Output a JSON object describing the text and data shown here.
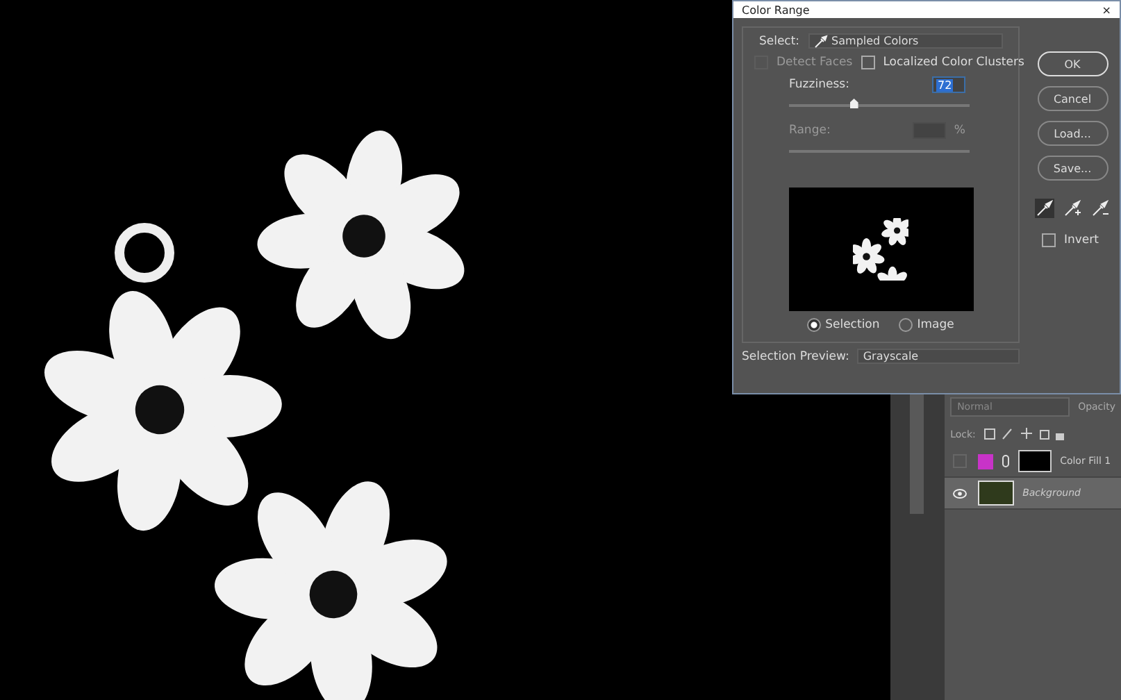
{
  "dialog": {
    "title": "Color Range",
    "close": "×",
    "select": {
      "label": "Select:",
      "value": "Sampled Colors"
    },
    "options": [
      {
        "label": "Detect Faces",
        "checked": false,
        "disabled": true
      },
      {
        "label": "Localized Color Clusters",
        "checked": false,
        "disabled": false
      }
    ],
    "fuzziness": {
      "label": "Fuzziness:",
      "value": "72",
      "level": 0.36
    },
    "range": {
      "label": "Range:",
      "unit": "%",
      "disabled": true
    },
    "preview_modes": [
      {
        "label": "Selection",
        "selected": true
      },
      {
        "label": "Image",
        "selected": false
      }
    ],
    "selection_preview": {
      "label": "Selection Preview:",
      "value": "Grayscale"
    },
    "buttons": [
      {
        "label": "OK",
        "default": true
      },
      {
        "label": "Cancel",
        "default": false
      },
      {
        "label": "Load...",
        "default": false
      },
      {
        "label": "Save...",
        "default": false
      }
    ],
    "eyedroppers": [
      {
        "kind": "sample",
        "selected": true
      },
      {
        "kind": "add",
        "selected": false
      },
      {
        "kind": "subtract",
        "selected": false
      }
    ],
    "invert": {
      "label": "Invert",
      "checked": false
    }
  },
  "layers_panel": {
    "blend_mode": "Normal",
    "opacity_label": "Opacity",
    "lock_label": "Lock:",
    "layers": [
      {
        "name": "Color Fill 1",
        "visible": false,
        "selected": false,
        "kind": "fill",
        "color": "#c833c8"
      },
      {
        "name": "Background",
        "visible": true,
        "selected": true,
        "kind": "image"
      }
    ]
  }
}
